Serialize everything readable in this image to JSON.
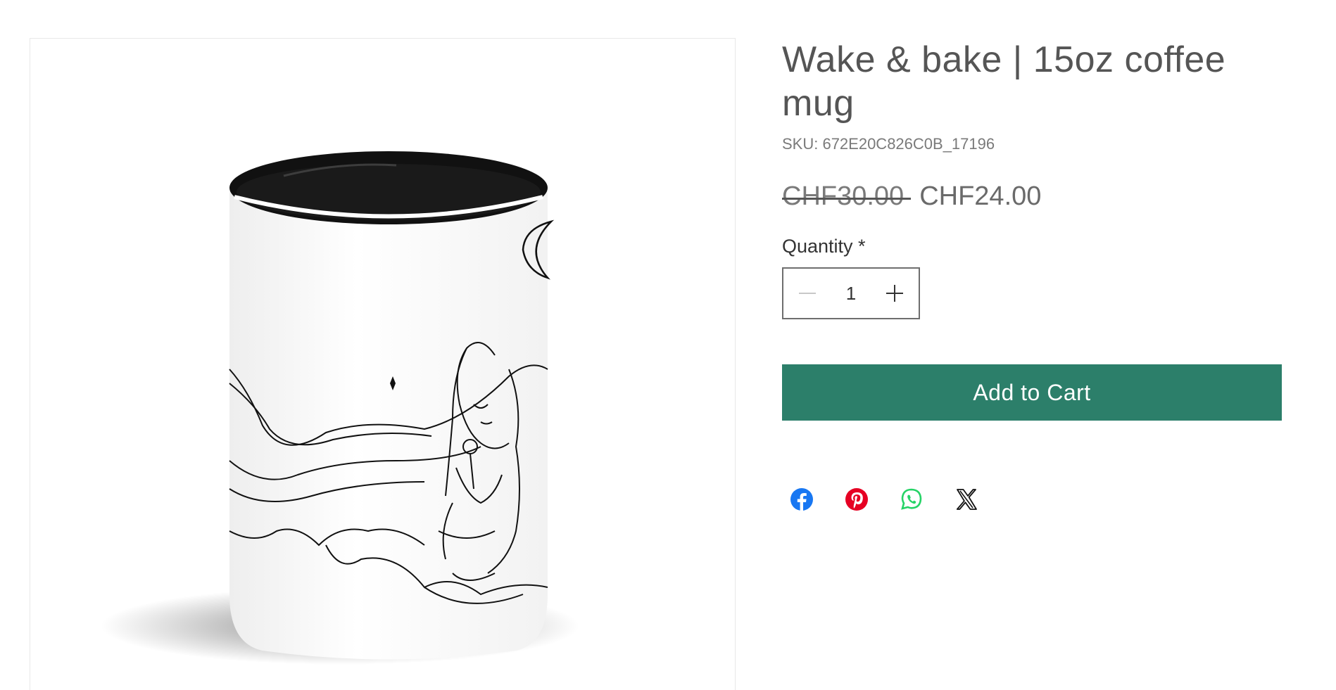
{
  "product": {
    "title": "Wake & bake | 15oz coffee mug",
    "sku": "SKU: 672E20C826C0B_17196",
    "price_original": "CHF30.00",
    "price_sale": "CHF24.00"
  },
  "quantity": {
    "label": "Quantity *",
    "value": "1"
  },
  "cart": {
    "add_label": "Add to Cart"
  },
  "share": {
    "icons": [
      "facebook-icon",
      "pinterest-icon",
      "whatsapp-icon",
      "x-icon"
    ]
  },
  "colors": {
    "accent": "#2c7f6a",
    "facebook": "#1877f2",
    "pinterest": "#e60023",
    "whatsapp": "#25d366"
  }
}
